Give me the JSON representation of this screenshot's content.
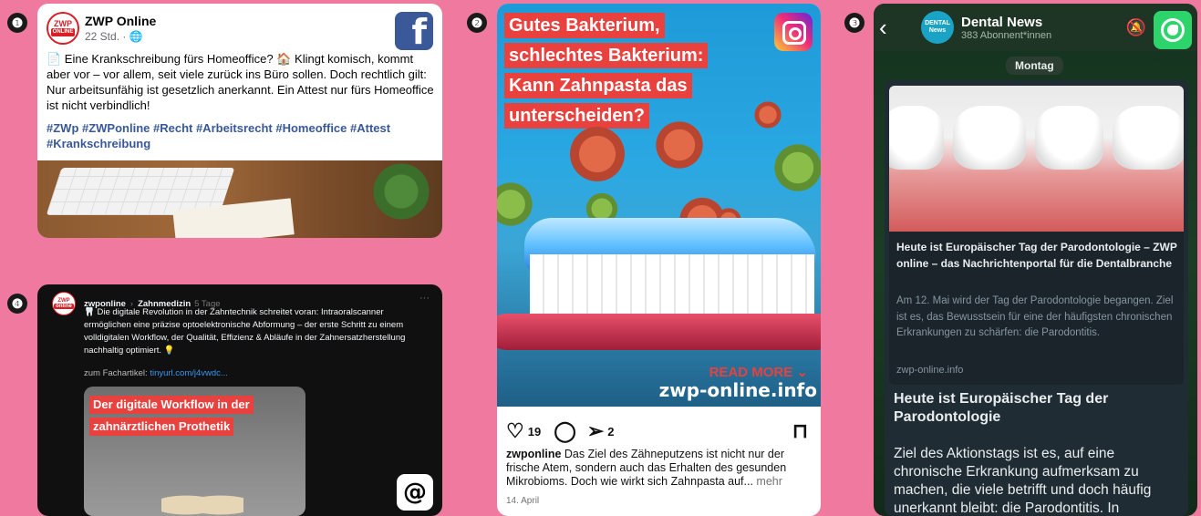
{
  "markers": [
    "❶",
    "❷",
    "❸",
    "❹"
  ],
  "facebook": {
    "page_name": "ZWP Online",
    "time": "22 Std. · 🌐",
    "logo_top": "ZWP",
    "logo_bottom": "ONLINE",
    "text": "📄 Eine Krankschreibung fürs Homeoffice? 🏠 Klingt komisch, kommt aber vor – vor allem, seit viele zurück ins Büro sollen. Doch rechtlich gilt: Nur arbeitsunfähig ist gesetzlich anerkannt. Ein Attest nur fürs Homeoffice ist nicht verbindlich!",
    "hashtags": "#ZWp #ZWPonline #Recht #Arbeitsrecht #Homeoffice #Attest #Krankschreibung",
    "brand_icon": "f",
    "brand_color": "#3b5998"
  },
  "instagram": {
    "headline": [
      "Gutes Bakterium,",
      "schlechtes Bakterium:",
      "Kann Zahnpasta das",
      "unterscheiden?"
    ],
    "read_more": "READ MORE ⌄",
    "url": "zwp-online.info",
    "likes": "19",
    "shares": "2",
    "caption_user": "zwponline",
    "caption": " Das Ziel des Zähneputzens ist nicht nur der frische Atem, sondern auch das Erhalten des gesunden Mikrobioms. Doch wie wirkt sich Zahnpasta auf...",
    "more": " mehr",
    "date": "14. April",
    "icons": {
      "like": "heart-icon",
      "comment": "comment-icon",
      "share": "send-icon",
      "save": "bookmark-icon"
    }
  },
  "messenger": {
    "back": "‹",
    "channel_name": "Dental News",
    "subscribers": "383 Abonnent*innen",
    "avatar_top": "DENTAL",
    "avatar_bottom": "News",
    "day": "Montag",
    "preview_title": "Heute ist Europäischer Tag der Parodontologie – ZWP online – das Nachrichtenportal für die Dentalbranche",
    "preview_desc": "Am 12. Mai wird der Tag der Parodontologie begangen. Ziel ist es, das Bewusstsein für eine der häufigsten chronischen Erkrankungen zu schärfen: die Parodontitis.",
    "preview_domain": "zwp-online.info",
    "message_title": "Heute ist Europäischer Tag der Parodontologie",
    "message_body": "Ziel des Aktionstags ist es, auf eine chronische Erkrankung aufmerksam zu machen, die viele betrifft und doch häufig unerkannt bleibt: die Parodontitis. In",
    "bell_icon": "🔕"
  },
  "threads": {
    "user": "zwponline",
    "sep": "›",
    "topic": "Zahnmedizin",
    "age": "5 Tage",
    "dots": "···",
    "text": "🦷 Die digitale Revolution in der Zahntechnik schreitet voran: Intraoralscanner ermöglichen eine präzise optoelektronische Abformung – der erste Schritt zu einem volldigitalen Workflow, der Qualität, Effizienz & Abläufe in der Zahnersatzherstellung nachhaltig optimiert. 💡",
    "link_label": "zum Fachartikel: ",
    "link_url": "tinyurl.com/j4vwdc...",
    "image_headline": [
      "Der digitale Workflow in der",
      "zahnärztlichen Prothetik"
    ],
    "brand_icon": "@",
    "logo_top": "ZWP",
    "logo_bottom": "online"
  }
}
